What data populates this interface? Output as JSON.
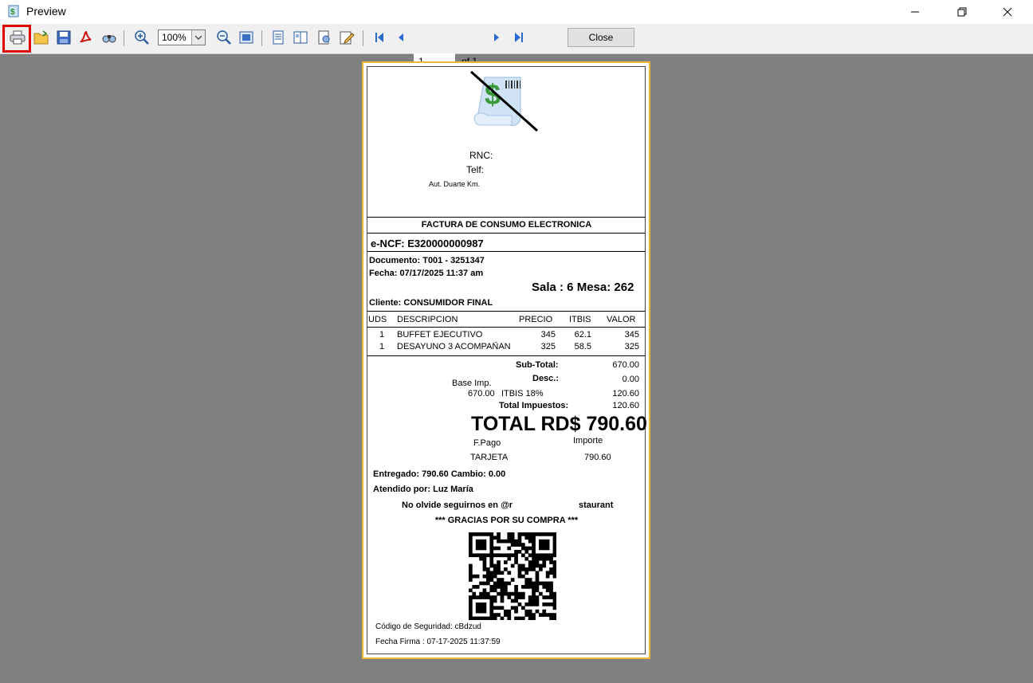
{
  "window": {
    "title": "Preview",
    "minimize_icon": "minimize-icon",
    "restore_icon": "restore-icon",
    "close_icon": "close-icon"
  },
  "toolbar": {
    "zoom_value": "100%",
    "page_input": "1",
    "page_of": "of 1",
    "close_label": "Close",
    "icons": [
      "print-icon",
      "open-icon",
      "save-icon",
      "pdf-export-icon",
      "find-icon",
      "zoom-in-icon",
      "zoom-out-icon",
      "full-page-icon",
      "page-setup-icon",
      "multiple-pages-icon",
      "watermark-icon",
      "edit-icon",
      "first-page-icon",
      "previous-page-icon",
      "next-page-icon",
      "last-page-icon"
    ]
  },
  "receipt": {
    "rnc_label": "RNC:",
    "telf_label": "Telf:",
    "address": "Aut. Duarte Km.",
    "doc_type": "FACTURA DE CONSUMO ELECTRONICA",
    "encf": "e-NCF: E320000000987",
    "documento": "Documento: T001 - 3251347",
    "fecha": "Fecha: 07/17/2025    11:37 am",
    "sala_mesa": "Sala : 6 Mesa: 262",
    "cliente": "Cliente: CONSUMIDOR FINAL",
    "columns": {
      "uds": "UDS",
      "descripcion": "DESCRIPCION",
      "precio": "PRECIO",
      "itbis": "ITBIS",
      "valor": "VALOR"
    },
    "items": [
      {
        "uds": "1",
        "descripcion": "BUFFET EJECUTIVO",
        "precio": "345",
        "itbis": "62.1",
        "valor": "345"
      },
      {
        "uds": "1",
        "descripcion": "DESAYUNO 3 ACOMPAÑAN",
        "precio": "325",
        "itbis": "58.5",
        "valor": "325"
      }
    ],
    "subtotal_label": "Sub-Total:",
    "subtotal_value": "670.00",
    "desc_label": "Desc.:",
    "desc_value": "0.00",
    "base_label": "Base Imp.",
    "base_value": "670.00",
    "itbis_label": "ITBIS 18%",
    "itbis_value": "120.60",
    "total_imp_label": "Total Impuestos:",
    "total_imp_value": "120.60",
    "total": "TOTAL RD$ 790.60",
    "fpago_label": "F.Pago",
    "importe_label": "Importe",
    "payment_method": "TARJETA",
    "payment_amount": "790.60",
    "entregado": "Entregado: 790.60 Cambio: 0.00",
    "atendido": "Atendido por:  Luz María",
    "follow_prefix": "No olvide seguirnos en @r",
    "follow_suffix": "staurant",
    "gracias": "*** GRACIAS POR SU COMPRA ***",
    "codigo": "Código de Seguridad: cBdzud",
    "fecha_firma": "Fecha Firma : 07-17-2025 11:37:59"
  }
}
